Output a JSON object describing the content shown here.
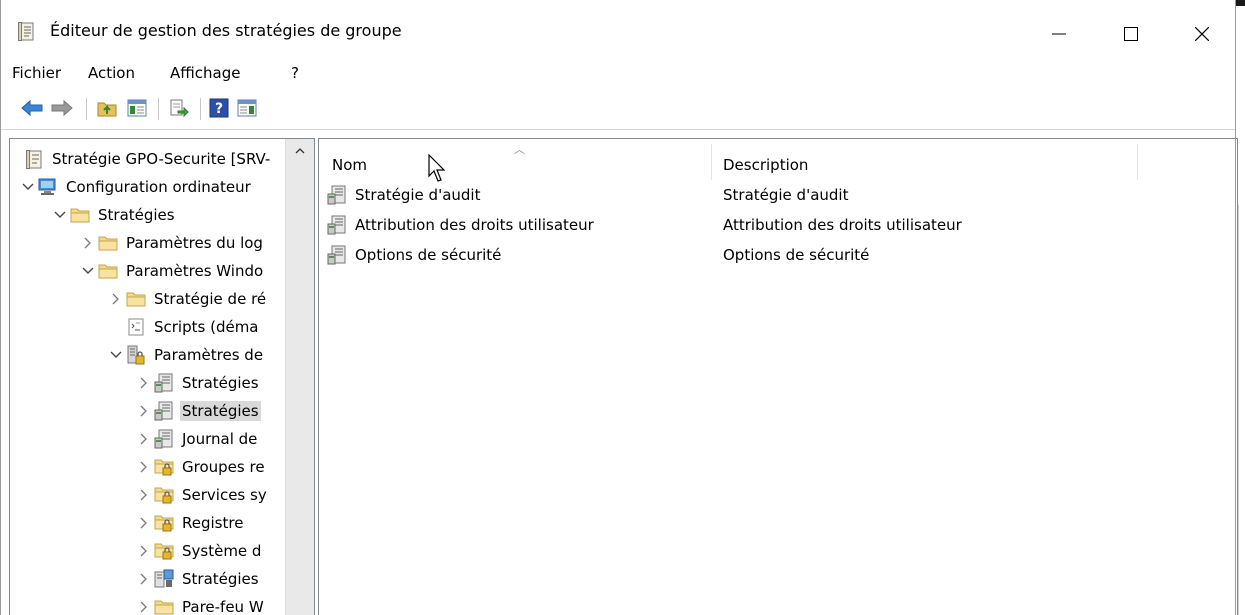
{
  "window": {
    "title": "Éditeur de gestion des stratégies de groupe",
    "controls": {
      "minimize": "—",
      "maximize": "☐",
      "close": "✕"
    }
  },
  "menu": [
    "Fichier",
    "Action",
    "Affichage",
    "?"
  ],
  "toolbar": [
    {
      "icon": "back-arrow-icon"
    },
    {
      "icon": "forward-arrow-icon"
    },
    {
      "icon": "up-folder-icon"
    },
    {
      "icon": "show-hide-tree-icon"
    },
    {
      "icon": "export-list-icon"
    },
    {
      "icon": "help-icon"
    },
    {
      "icon": "show-action-pane-icon"
    }
  ],
  "tree": [
    {
      "label": "Stratégie GPO-Securite [SRV-",
      "icon": "policy-doc-icon",
      "twisty": "",
      "level": 0
    },
    {
      "label": "Configuration ordinateur",
      "icon": "computer-icon",
      "twisty": "expanded",
      "level": 0
    },
    {
      "label": "Stratégies",
      "icon": "folder-icon",
      "twisty": "expanded",
      "level": 1
    },
    {
      "label": "Paramètres du log",
      "icon": "folder-icon",
      "twisty": "collapsed",
      "level": 2
    },
    {
      "label": "Paramètres Windo",
      "icon": "folder-icon",
      "twisty": "expanded",
      "level": 2
    },
    {
      "label": "Stratégie de ré",
      "icon": "folder-icon",
      "twisty": "collapsed",
      "level": 3
    },
    {
      "label": "Scripts (déma",
      "icon": "script-icon",
      "twisty": "",
      "level": 3
    },
    {
      "label": "Paramètres de",
      "icon": "security-settings-icon",
      "twisty": "expanded",
      "level": 3
    },
    {
      "label": "Stratégies",
      "icon": "policy-node-icon",
      "twisty": "collapsed",
      "level": 4
    },
    {
      "label": "Stratégies",
      "icon": "policy-node-icon",
      "twisty": "collapsed",
      "level": 4,
      "selected": true
    },
    {
      "label": "Journal de",
      "icon": "policy-node-icon",
      "twisty": "collapsed",
      "level": 4
    },
    {
      "label": "Groupes re",
      "icon": "locked-folder-icon",
      "twisty": "collapsed",
      "level": 4
    },
    {
      "label": "Services sy",
      "icon": "locked-folder-icon",
      "twisty": "collapsed",
      "level": 4
    },
    {
      "label": "Registre",
      "icon": "locked-folder-icon",
      "twisty": "collapsed",
      "level": 4
    },
    {
      "label": "Système d",
      "icon": "locked-folder-icon",
      "twisty": "collapsed",
      "level": 4
    },
    {
      "label": "Stratégies",
      "icon": "network-policy-icon",
      "twisty": "collapsed",
      "level": 4
    },
    {
      "label": "Pare-feu W",
      "icon": "folder-icon",
      "twisty": "collapsed",
      "level": 4
    }
  ],
  "list": {
    "columns": {
      "name": "Nom",
      "description": "Description"
    },
    "rows": [
      {
        "name": "Stratégie d'audit",
        "description": "Stratégie d'audit"
      },
      {
        "name": "Attribution des droits utilisateur",
        "description": "Attribution des droits utilisateur"
      },
      {
        "name": "Options de sécurité",
        "description": "Options de sécurité"
      }
    ]
  }
}
